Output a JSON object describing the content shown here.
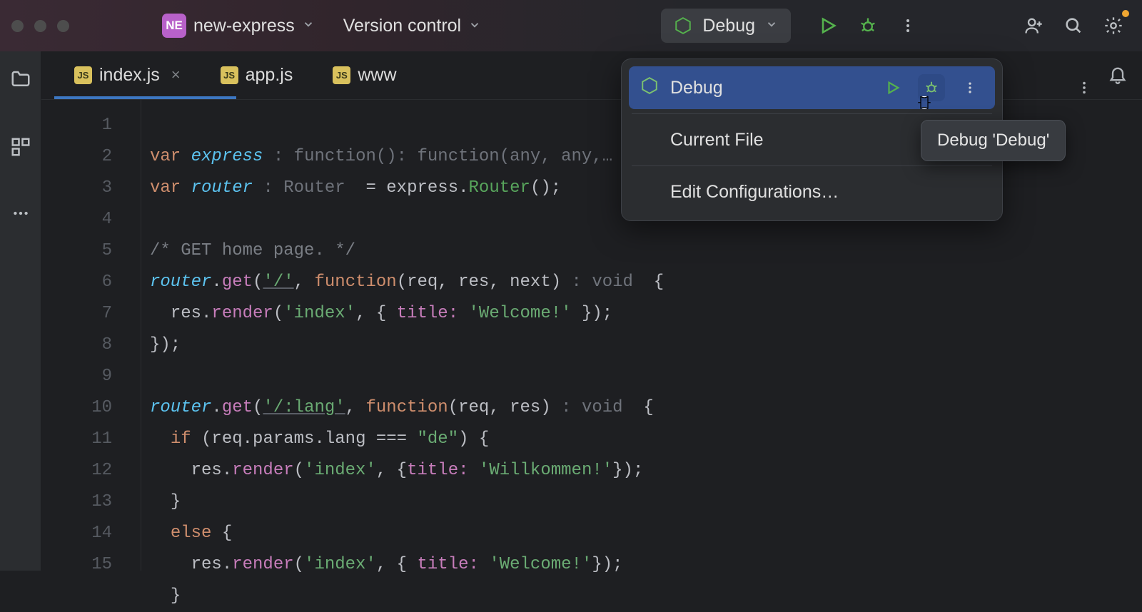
{
  "header": {
    "project_icon": "NE",
    "project_name": "new-express",
    "version_control": "Version control",
    "run_config": "Debug"
  },
  "tabs": [
    {
      "label": "index.js",
      "close": true
    },
    {
      "label": "app.js",
      "close": false
    },
    {
      "label": "www",
      "close": false
    }
  ],
  "editor": {
    "lines": [
      "1",
      "2",
      "3",
      "4",
      "5",
      "6",
      "7",
      "8",
      "9",
      "10",
      "11",
      "12",
      "13",
      "14",
      "15"
    ]
  },
  "code": {
    "var": "var",
    "express": "express",
    "h1": " : function(): function(any, any,… | {…}",
    "router": "router",
    "rhint": " : Router",
    "eq": "  = ",
    "expcall": "express",
    "Router": "Router",
    "paren": "();",
    "comment": "/* GET home page. */",
    "get": "get",
    "slash": "'/'",
    "func": "function",
    "sig1": "(req, res, next)",
    "void": " : void",
    "brace": "  {",
    "render": "render",
    "idx": "'index'",
    "title": "title:",
    "welcome": "'Welcome!'",
    "close1": " });",
    "endfn": "});",
    "langroute": "'/:lang'",
    "sig2": "(req, res)",
    "if": "if",
    "cond": " (req.params.lang === ",
    "de": "\"de\"",
    "rb": ") {",
    "will": "'Willkommen!'",
    "rb2": "});",
    "cb": "}",
    "else": "else",
    " ob": " {"
  },
  "dropdown": {
    "debug": "Debug",
    "current": "Current File",
    "edit": "Edit Configurations…"
  },
  "tooltip": "Debug 'Debug'"
}
